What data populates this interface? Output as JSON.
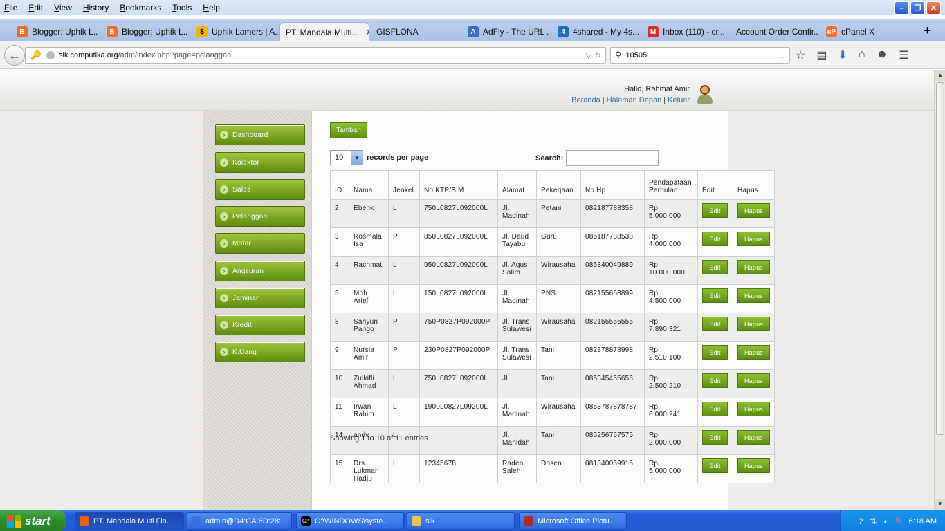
{
  "menubar": {
    "items": [
      "File",
      "Edit",
      "View",
      "History",
      "Bookmarks",
      "Tools",
      "Help"
    ]
  },
  "tabs": [
    {
      "label": "Blogger: Uphik L...",
      "icon": "blogger-icon",
      "color": "#f26c21"
    },
    {
      "label": "Blogger: Uphik L...",
      "icon": "blogger-icon",
      "color": "#f26c21"
    },
    {
      "label": "Uphik Lamers | A...",
      "icon": "dollar-icon",
      "color": "#f5b400"
    },
    {
      "label": "PT. Mandala Multi...",
      "icon": "",
      "color": "",
      "active": true
    },
    {
      "label": "GISFLONA",
      "icon": "",
      "color": ""
    },
    {
      "label": "AdFly - The URL ...",
      "icon": "adfly-icon",
      "color": "#3c6cc9"
    },
    {
      "label": "4shared - My 4s...",
      "icon": "4shared-icon",
      "color": "#1e6fbf"
    },
    {
      "label": "Inbox (110) - cr...",
      "icon": "gmail-icon",
      "color": "#d93025"
    },
    {
      "label": "Account Order Confir...",
      "icon": "",
      "color": ""
    },
    {
      "label": "cPanel X",
      "icon": "cpanel-icon",
      "color": "#ff6c2c"
    }
  ],
  "navbar": {
    "url_host": "sik.computika.org",
    "url_path": "/adm/index.php?page=pelanggan",
    "search_value": "10505"
  },
  "header": {
    "greeting": "Hallo, Rahmat Amir",
    "links": [
      "Beranda",
      "Halaman Depan",
      "Keluar"
    ],
    "separator": "|"
  },
  "sidebar": {
    "items": [
      "Dashboard",
      "Kolektor",
      "Sales",
      "Pelanggan",
      "Motor",
      "Angsuran",
      "Jaminan",
      "Kredit",
      "K.Uang"
    ]
  },
  "content": {
    "add_button": "Tambah",
    "page_length": "10",
    "page_length_label": "records per page",
    "search_label": "Search:",
    "showing": "Showing 1 to 10 of 11 entries"
  },
  "table": {
    "headers": [
      "ID",
      "Nama",
      "Jenkel",
      "No KTP/SIM",
      "Alamat",
      "Pekerjaan",
      "No Hp",
      "Pendapataan Perbulan",
      "Edit",
      "Hapus"
    ],
    "edit_label": "Edit",
    "delete_label": "Hapus",
    "rows": [
      {
        "id": "2",
        "nama": "Ebenk",
        "jenkel": "L",
        "ktp": "750L0827L092000L",
        "alamat": "Jl. Madinah",
        "pekerjaan": "Petani",
        "hp": "082187788358",
        "pendapatan": "Rp. 5.000.000"
      },
      {
        "id": "3",
        "nama": "Rosmala Isa",
        "jenkel": "P",
        "ktp": "850L0827L092000L",
        "alamat": "Jl. Daud Tayabu",
        "pekerjaan": "Guru",
        "hp": "085187788538",
        "pendapatan": "Rp. 4.000.000"
      },
      {
        "id": "4",
        "nama": "Rachmat",
        "jenkel": "L",
        "ktp": "950L0827L092000L",
        "alamat": "Jl. Agus Salim",
        "pekerjaan": "Wirausaha",
        "hp": "085340049889",
        "pendapatan": "Rp. 10.000.000"
      },
      {
        "id": "5",
        "nama": "Moh. Arief",
        "jenkel": "L",
        "ktp": "150L0827L092000L",
        "alamat": "Jl. Madinah",
        "pekerjaan": "PNS",
        "hp": "082155668899",
        "pendapatan": "Rp. 4.500.000"
      },
      {
        "id": "8",
        "nama": "Sahyun Pango",
        "jenkel": "P",
        "ktp": "750P0827P092000P",
        "alamat": "Jl. Trans Sulawesi",
        "pekerjaan": "Wirausaha",
        "hp": "082155555555",
        "pendapatan": "Rp. 7.890.321"
      },
      {
        "id": "9",
        "nama": "Nursia Amir",
        "jenkel": "P",
        "ktp": "230P0827P092000P",
        "alamat": "Jl. Trans Sulawesi",
        "pekerjaan": "Tani",
        "hp": "082378878998",
        "pendapatan": "Rp. 2.510.100"
      },
      {
        "id": "10",
        "nama": "Zulkifli Ahmad",
        "jenkel": "L",
        "ktp": "750L0827L092000L",
        "alamat": "Jl.",
        "pekerjaan": "Tani",
        "hp": "085345455656",
        "pendapatan": "Rp. 2.500.210"
      },
      {
        "id": "11",
        "nama": "Irwan Rahim",
        "jenkel": "L",
        "ktp": "1900L0827L09200L",
        "alamat": "Jl. Madinah",
        "pekerjaan": "Wirausaha",
        "hp": "0853787878787",
        "pendapatan": "Rp. 6.000.241"
      },
      {
        "id": "14",
        "nama": "andy",
        "jenkel": "L",
        "ktp": "",
        "alamat": "Jl. Manidah",
        "pekerjaan": "Tani",
        "hp": "085256757575",
        "pendapatan": "Rp. 2.000.000"
      },
      {
        "id": "15",
        "nama": "Drs. Lukman Hadju",
        "jenkel": "L",
        "ktp": "12345678",
        "alamat": "Raden Saleh",
        "pekerjaan": "Dosen",
        "hp": "081340069915",
        "pendapatan": "Rp. 5.000.000"
      }
    ]
  },
  "taskbar": {
    "start_label": "start",
    "tasks": [
      {
        "label": "PT. Mandala Multi Fin...",
        "icon": "firefox-icon",
        "color": "#e66000"
      },
      {
        "label": "admin@D4:CA:6D:28:...",
        "icon": "winbox-icon",
        "color": "#3a6fd8"
      },
      {
        "label": "C:\\WINDOWS\\syste...",
        "icon": "cmd-icon",
        "color": "#000000"
      },
      {
        "label": "sik",
        "icon": "folder-icon",
        "color": "#e8c45a"
      },
      {
        "label": "Microsoft Office Pictu...",
        "icon": "picture-manager-icon",
        "color": "#b3281e"
      }
    ],
    "clock": "6:18 AM"
  }
}
